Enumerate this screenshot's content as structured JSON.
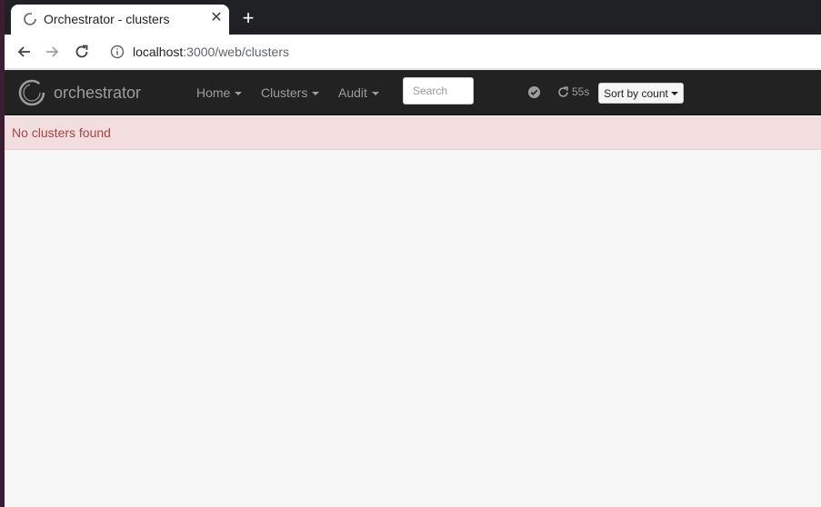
{
  "browser": {
    "tab": {
      "title": "Orchestrator - clusters",
      "close_glyph": "✕"
    },
    "new_tab_glyph": "+",
    "address": {
      "host": "localhost",
      "path": ":3000/web/clusters"
    }
  },
  "navbar": {
    "brand": "orchestrator",
    "menu": [
      {
        "label": "Home"
      },
      {
        "label": "Clusters"
      },
      {
        "label": "Audit"
      }
    ],
    "search": {
      "placeholder": "Search",
      "value": ""
    },
    "refresh_countdown": "55s",
    "sort_button": "Sort by count"
  },
  "alert": {
    "text": "No clusters found"
  },
  "colors": {
    "navbar_bg": "#222222",
    "nav_text": "#9d9d9d",
    "alert_bg": "#f2dede",
    "alert_text": "#a94442",
    "page_bg": "#f6f6f6"
  },
  "icons": [
    "app-favicon-icon",
    "close-icon",
    "plus-icon",
    "back-arrow-icon",
    "forward-arrow-icon",
    "reload-icon",
    "info-icon",
    "orchestrator-logo-icon",
    "check-circle-icon",
    "refresh-icon"
  ]
}
